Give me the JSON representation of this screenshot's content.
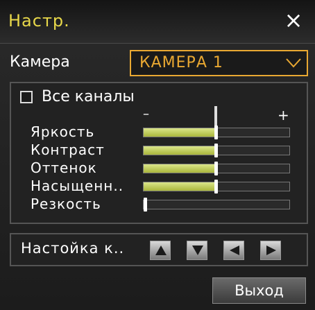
{
  "window": {
    "title": "Настр.",
    "close_symbol": "×"
  },
  "camera": {
    "label": "Камера",
    "selected": "КАМЕРА 1"
  },
  "all_channels": {
    "label": "Все каналы",
    "checked": false
  },
  "scale": {
    "minus": "–",
    "plus": "+"
  },
  "sliders": [
    {
      "label": "Яркость",
      "value_percent": 50
    },
    {
      "label": "Контраст",
      "value_percent": 50
    },
    {
      "label": "Оттенок",
      "value_percent": 50
    },
    {
      "label": "Насыщенн..",
      "value_percent": 50
    },
    {
      "label": "Резкость",
      "value_percent": 0
    }
  ],
  "adjust": {
    "label": "Настойка к..",
    "buttons": [
      "up-arrow-icon",
      "down-arrow-icon",
      "left-arrow-icon",
      "right-arrow-icon"
    ]
  },
  "exit": {
    "label": "Выход"
  },
  "colors": {
    "title": "#e8d84a",
    "select_accent": "#e9a832",
    "slider_fill": "#c9d65a"
  }
}
